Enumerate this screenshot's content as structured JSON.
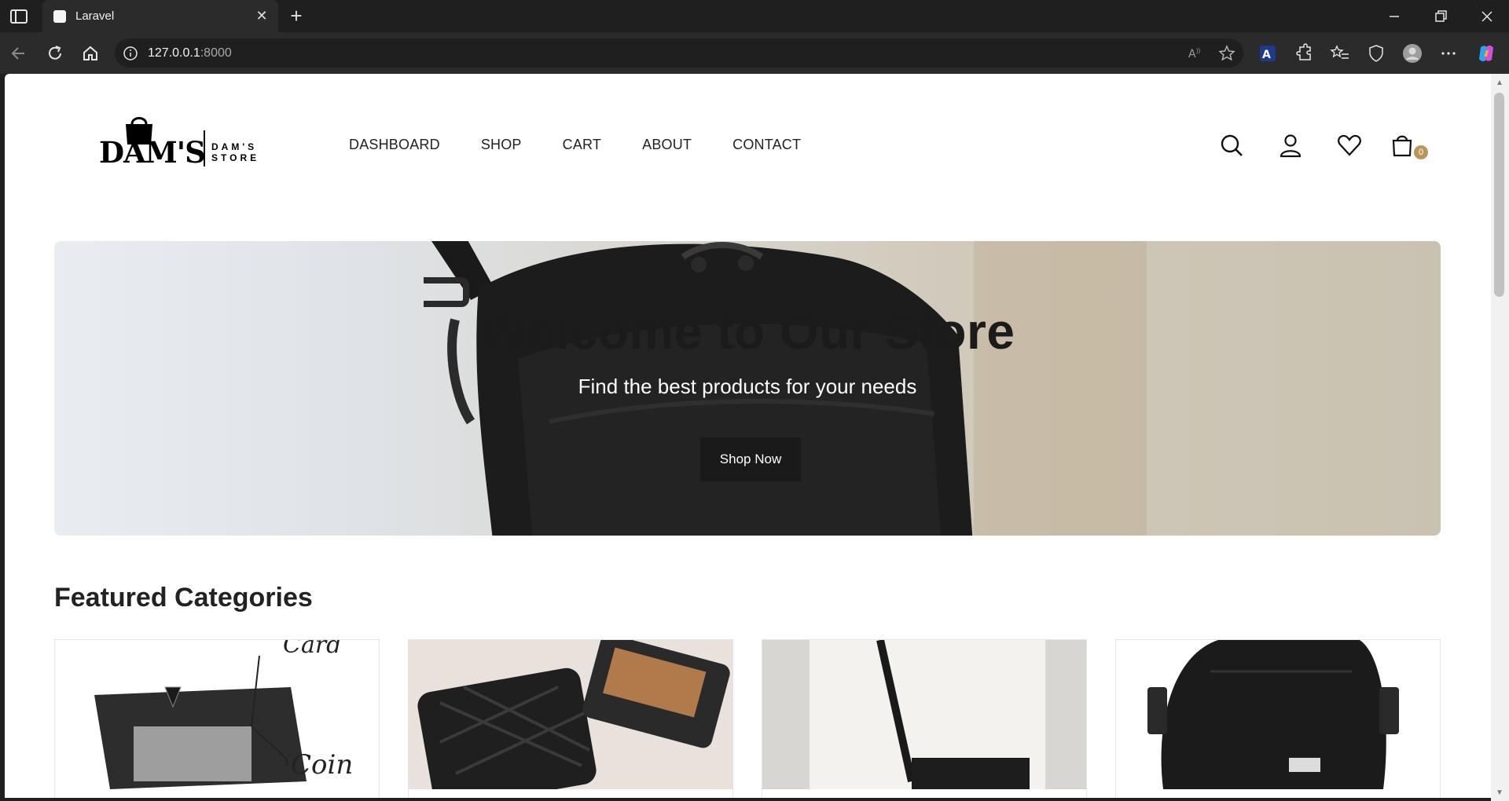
{
  "browser": {
    "tab_title": "Laravel",
    "url_host": "127.0.0.1",
    "url_port": ":8000"
  },
  "header": {
    "logo_main": "DAM'S",
    "logo_sub": "DAM'S STORE",
    "nav": [
      "DASHBOARD",
      "SHOP",
      "CART",
      "ABOUT",
      "CONTACT"
    ],
    "cart_count": "0"
  },
  "hero": {
    "title": "Welcome to Our Store",
    "subtitle": "Find the best products for your needs",
    "button": "Shop Now"
  },
  "featured": {
    "title": "Featured Categories",
    "card_labels": [
      "Card",
      "Coin"
    ]
  },
  "colors": {
    "accent": "#b9975b",
    "dark": "#1a1a1a"
  }
}
